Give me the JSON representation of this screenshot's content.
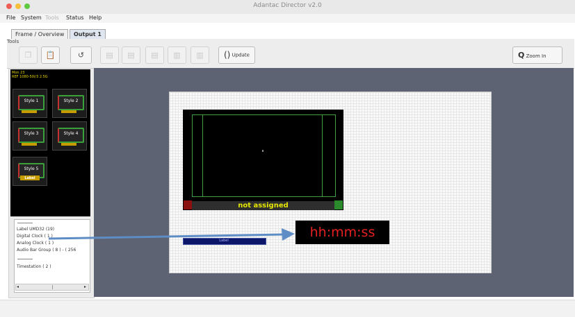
{
  "window": {
    "title": "Adantac Director v2.0",
    "traffic_lights": {
      "close": "#ee5e57",
      "minimize": "#f5bf3a",
      "zoom": "#5fc93f"
    }
  },
  "menu": [
    "File",
    "System",
    "Tools",
    "Status",
    "Help"
  ],
  "tabs": [
    "Frame / Overview",
    "Output 1"
  ],
  "tools": {
    "label": "Tools",
    "update_label": "Update",
    "zoom_label": "Zoom In",
    "icons": [
      "copy-icon",
      "paste-icon",
      "undo-icon",
      "align-left-icon",
      "align-center-icon",
      "align-right-icon",
      "align-top-icon",
      "align-bottom-icon",
      "refresh-icon",
      "magnifier-icon"
    ]
  },
  "style_panel": {
    "info_line_1": "Mon 23",
    "info_line_2": "REF 1080-50i/3 2.5G",
    "styles": [
      {
        "label": "Style 1",
        "type": "small"
      },
      {
        "label": "Style 2",
        "type": "small"
      },
      {
        "label": "Style 3",
        "type": "small"
      },
      {
        "label": "Style 4",
        "type": "small"
      },
      {
        "label": "Style 5",
        "type": "big",
        "bar_label": "Label"
      }
    ]
  },
  "element_list": {
    "items": [
      "Label UMD32 (19)",
      "Digital Clock ( 1 )",
      "Analog Clock ( 1 )",
      "Audio Bar Group ( 8 ) - ( 256",
      "Timestation ( 2 )"
    ]
  },
  "canvas": {
    "not_assigned_label": "not assigned",
    "clock_text": "hh:mm:ss",
    "label_bar_text": "Label",
    "colors": {
      "canvas_bg": "#5e6373",
      "clock_text": "#e42020",
      "na_text": "#e5e500",
      "frame_green": "#3fa03f",
      "arrow_blue": "#5d8dc4"
    }
  }
}
